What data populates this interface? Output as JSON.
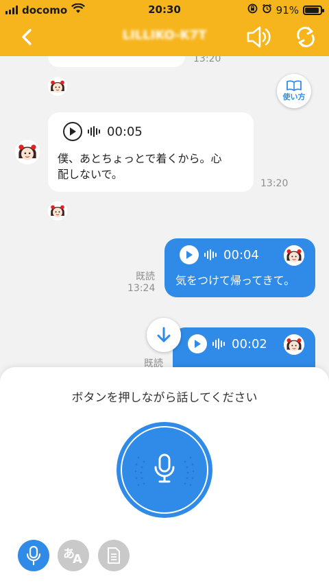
{
  "status": {
    "carrier": "docomo",
    "time": "20:30",
    "battery_text": "91%",
    "battery_level": 0.91
  },
  "nav": {
    "title": "LILLIKO-K7T"
  },
  "guide": {
    "label": "使い方"
  },
  "messages": [
    {
      "side": "in",
      "time": "13:20"
    },
    {
      "side": "in",
      "duration": "00:05",
      "text_line1": "僕、あとちょっとで着くから。心",
      "text_line2": "配しないで。",
      "time": "13:20"
    },
    {
      "side": "out",
      "duration": "00:04",
      "text": "気をつけて帰ってきて。",
      "read": "既読",
      "time": "13:24"
    },
    {
      "side": "out",
      "duration": "00:02",
      "read": "既読"
    }
  ],
  "sheet": {
    "prompt": "ボタンを押しながら話してください"
  },
  "tools": {
    "translate_glyph_a": "あ",
    "translate_glyph_b": "A"
  },
  "colors": {
    "accent": "#2f8ae8",
    "header": "#f6b51c",
    "background": "#f2f2f2"
  }
}
